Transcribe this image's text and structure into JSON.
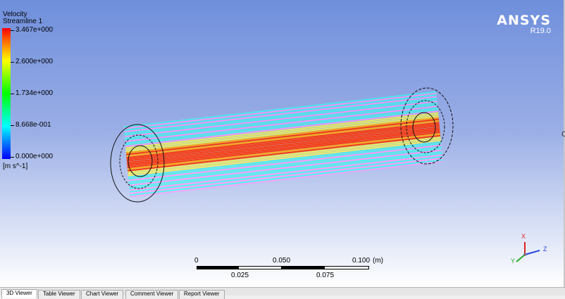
{
  "legend": {
    "variable": "Velocity",
    "object": "Streamline 1",
    "values": [
      "3.467e+000",
      "2.600e+000",
      "1.734e+000",
      "8.668e-001",
      "0.000e+000"
    ],
    "unit": "[m s^-1]"
  },
  "brand": {
    "name": "ANSYS",
    "version": "R19.0"
  },
  "scale": {
    "top_labels": [
      "0",
      "0.050",
      "0.100"
    ],
    "unit": "(m)",
    "bottom_labels": [
      "0.025",
      "0.075"
    ]
  },
  "axes": {
    "x": "X",
    "y": "Y",
    "z": "Z"
  },
  "tabs": [
    "3D Viewer",
    "Table Viewer",
    "Chart Viewer",
    "Comment Viewer",
    "Report Viewer"
  ],
  "colors": {
    "streamline_high": "#ff3300",
    "streamline_mid_high": "#ffaa00",
    "streamline_mid": "#ffff33",
    "streamline_low": "#33ffee",
    "streamline_vlow": "#ff99ff"
  }
}
